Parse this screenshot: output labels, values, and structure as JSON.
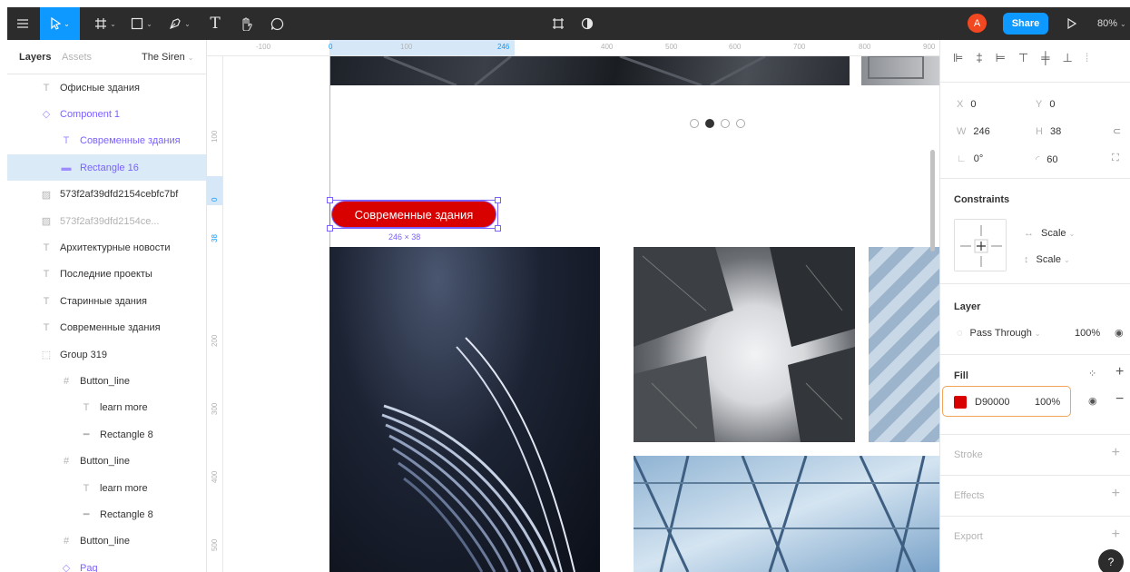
{
  "toolbar": {
    "avatar_initial": "A",
    "share_label": "Share",
    "zoom_label": "80%"
  },
  "left_panel": {
    "tabs": [
      "Layers",
      "Assets"
    ],
    "page_name": "The Siren",
    "layers": [
      {
        "label": "Офисные здания",
        "icon": "text-icon",
        "indent": 0,
        "style": "normal"
      },
      {
        "label": "Component 1",
        "icon": "component-icon",
        "indent": 0,
        "style": "purple"
      },
      {
        "label": "Современные здания",
        "icon": "text-icon",
        "indent": 1,
        "style": "purple"
      },
      {
        "label": "Rectangle 16",
        "icon": "rectangle-icon",
        "indent": 1,
        "style": "purple-selected"
      },
      {
        "label": "573f2af39dfd2154cebfc7bf",
        "icon": "image-icon",
        "indent": 0,
        "style": "normal"
      },
      {
        "label": "573f2af39dfd2154ce...",
        "icon": "image-icon",
        "indent": 0,
        "style": "faded"
      },
      {
        "label": "Архитектурные новости",
        "icon": "text-icon",
        "indent": 0,
        "style": "normal"
      },
      {
        "label": "Последние проекты",
        "icon": "text-icon",
        "indent": 0,
        "style": "normal"
      },
      {
        "label": "Старинные здания",
        "icon": "text-icon",
        "indent": 0,
        "style": "normal"
      },
      {
        "label": "Современные здания",
        "icon": "text-icon",
        "indent": 0,
        "style": "normal"
      },
      {
        "label": "Group 319",
        "icon": "group-icon",
        "indent": 0,
        "style": "normal"
      },
      {
        "label": "Button_line",
        "icon": "frame-icon",
        "indent": 1,
        "style": "normal"
      },
      {
        "label": "learn more",
        "icon": "text-icon",
        "indent": 2,
        "style": "normal"
      },
      {
        "label": "Rectangle 8",
        "icon": "line-icon",
        "indent": 2,
        "style": "normal"
      },
      {
        "label": "Button_line",
        "icon": "frame-icon",
        "indent": 1,
        "style": "normal"
      },
      {
        "label": "learn more",
        "icon": "text-icon",
        "indent": 2,
        "style": "normal"
      },
      {
        "label": "Rectangle 8",
        "icon": "line-icon",
        "indent": 2,
        "style": "normal"
      },
      {
        "label": "Button_line",
        "icon": "frame-icon",
        "indent": 1,
        "style": "normal"
      },
      {
        "label": "Pag",
        "icon": "component-icon",
        "indent": 1,
        "style": "purple"
      }
    ]
  },
  "rulers": {
    "top": [
      "-100",
      "0",
      "100",
      "246",
      "400",
      "500",
      "600",
      "700",
      "800",
      "900"
    ],
    "left": [
      "100",
      "0",
      "38",
      "200",
      "300",
      "400",
      "500"
    ]
  },
  "canvas": {
    "button_label": "Современные здания",
    "button_color": "#D90000",
    "selection_size": "246 × 38",
    "selection_color": "#7b61ff"
  },
  "right_panel": {
    "x": {
      "label": "X",
      "value": "0"
    },
    "y": {
      "label": "Y",
      "value": "0"
    },
    "w": {
      "label": "W",
      "value": "246"
    },
    "h": {
      "label": "H",
      "value": "38"
    },
    "rotation": "0°",
    "radius": "60",
    "constraints_title": "Constraints",
    "constraint_h": "Scale",
    "constraint_v": "Scale",
    "layer_title": "Layer",
    "blend_mode": "Pass Through",
    "layer_opacity": "100%",
    "fill_title": "Fill",
    "fill_hex": "D90000",
    "fill_opacity": "100%",
    "fill_swatch": "#D90000",
    "stroke_title": "Stroke",
    "effects_title": "Effects",
    "export_title": "Export",
    "help": "?"
  }
}
